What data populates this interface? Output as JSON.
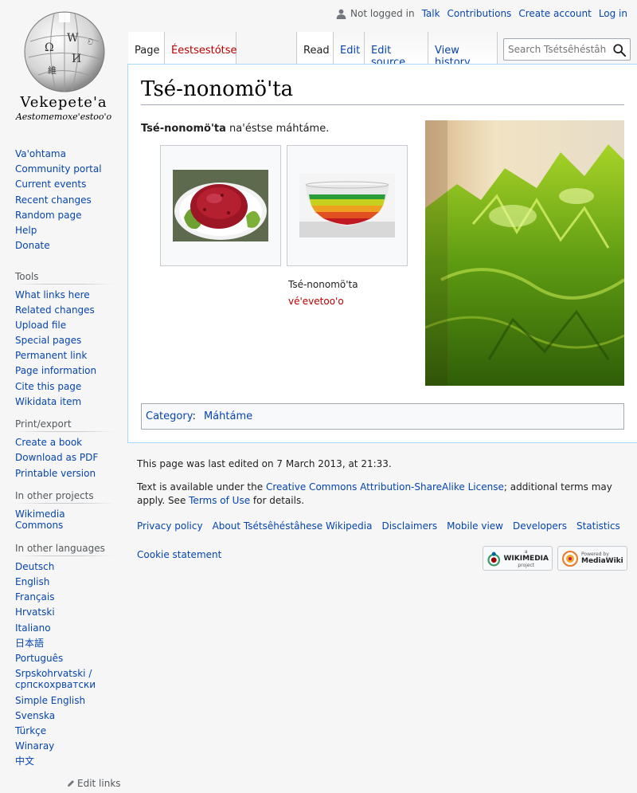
{
  "logo": {
    "wordmark": "Vekepete'a",
    "tagline": "Aestomemoxe'estoo'o"
  },
  "personal": {
    "not_logged_in": "Not logged in",
    "talk": "Talk",
    "contributions": "Contributions",
    "create_account": "Create account",
    "log_in": "Log in"
  },
  "tabs": {
    "page": "Page",
    "talk": "Éestsestótse",
    "read": "Read",
    "edit": "Edit",
    "edit_source": "Edit source",
    "view_history": "View history"
  },
  "search": {
    "placeholder": "Search Tsétsêhéstâhese Wikipedia"
  },
  "article": {
    "title": "Tsé-nonomö'ta",
    "lead_bold": "Tsé-nonomö'ta",
    "lead_rest": " na'éstse máhtáme.",
    "caption_line1": "Tsé-nonomö'ta",
    "caption_line2": "vé'evetoo'o"
  },
  "category": {
    "label": "Category",
    "sep": ":",
    "item": "Máhtáme"
  },
  "sidebar": {
    "nav": [
      "Va'ohtama",
      "Community portal",
      "Current events",
      "Recent changes",
      "Random page",
      "Help",
      "Donate"
    ],
    "tools_heading": "Tools",
    "tools": [
      "What links here",
      "Related changes",
      "Upload file",
      "Special pages",
      "Permanent link",
      "Page information",
      "Cite this page",
      "Wikidata item"
    ],
    "print_heading": "Print/export",
    "print": [
      "Create a book",
      "Download as PDF",
      "Printable version"
    ],
    "projects_heading": "In other projects",
    "projects": [
      "Wikimedia Commons"
    ],
    "languages_heading": "In other languages",
    "languages": [
      "Deutsch",
      "English",
      "Français",
      "Hrvatski",
      "Italiano",
      "日本語",
      "Português",
      "Srpskohrvatski / српскохрватски",
      "Simple English",
      "Svenska",
      "Türkçe",
      "Winaray",
      "中文"
    ],
    "edit_links": "Edit links"
  },
  "footer": {
    "last_edited": "This page was last edited on 7 March 2013, at 21:33.",
    "license_prefix": "Text is available under the ",
    "license_link": "Creative Commons Attribution-ShareAlike License",
    "license_middle": "; additional terms may apply. See ",
    "terms_link": "Terms of Use",
    "license_suffix": " for details.",
    "places": [
      "Privacy policy",
      "About Tsétsêhéstâhese Wikipedia",
      "Disclaimers",
      "Mobile view",
      "Developers",
      "Statistics"
    ],
    "cookie": "Cookie statement",
    "wm_small": "a",
    "wm_big": "WIKIMEDIA",
    "wm_small2": "project",
    "mw_small": "Powered by",
    "mw_big": "MediaWiki"
  },
  "colors": {
    "link": "#0645ad",
    "redlink": "#ba0000",
    "border": "#a7d7f9"
  }
}
